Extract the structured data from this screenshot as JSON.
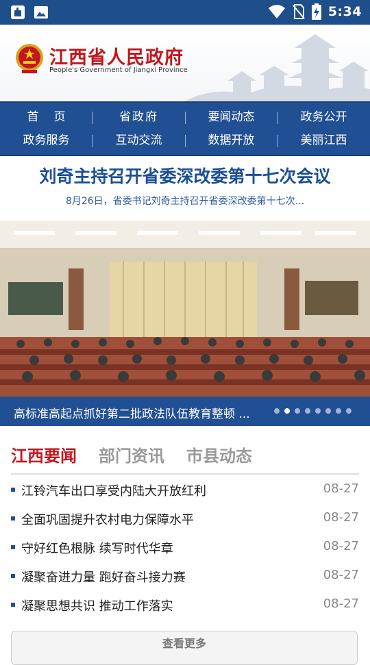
{
  "status_bar": {
    "time": "5:34",
    "left_icons": [
      "app-notification-icon",
      "image-icon"
    ],
    "right_icons": [
      "wifi-icon",
      "no-sim-icon",
      "battery-charging-icon"
    ]
  },
  "header": {
    "title": "江西省人民政府",
    "subtitle": "People's Government of Jiangxi Province"
  },
  "nav": {
    "row1": [
      "首页",
      "省政府",
      "要闻动态",
      "政务公开"
    ],
    "row2": [
      "政务服务",
      "互动交流",
      "数据开放",
      "美丽江西"
    ]
  },
  "headline": {
    "title": "刘奇主持召开省委深改委第十七次会议",
    "summary": "8月26日，省委书记刘奇主持召开省委深改委第十七次..."
  },
  "carousel": {
    "caption": "高标准高起点抓好第二批政法队伍教育整顿 ...",
    "slide_count": 8,
    "active_index": 1
  },
  "tabs": [
    {
      "label": "江西要闻",
      "active": true
    },
    {
      "label": "部门资讯",
      "active": false
    },
    {
      "label": "市县动态",
      "active": false
    }
  ],
  "news": [
    {
      "title": "江铃汽车出口享受内陆大开放红利",
      "date": "08-27"
    },
    {
      "title": "全面巩固提升农村电力保障水平",
      "date": "08-27"
    },
    {
      "title": "守好红色根脉 续写时代华章",
      "date": "08-27"
    },
    {
      "title": "凝聚奋进力量 跑好奋斗接力赛",
      "date": "08-27"
    },
    {
      "title": "凝聚思想共识 推动工作落实",
      "date": "08-27"
    }
  ],
  "more_button": "查看更多",
  "colors": {
    "primary_blue": "#214f93",
    "status_bar": "#1f4f8b",
    "brand_red": "#c4161c",
    "headline_blue": "#1c4f96"
  }
}
